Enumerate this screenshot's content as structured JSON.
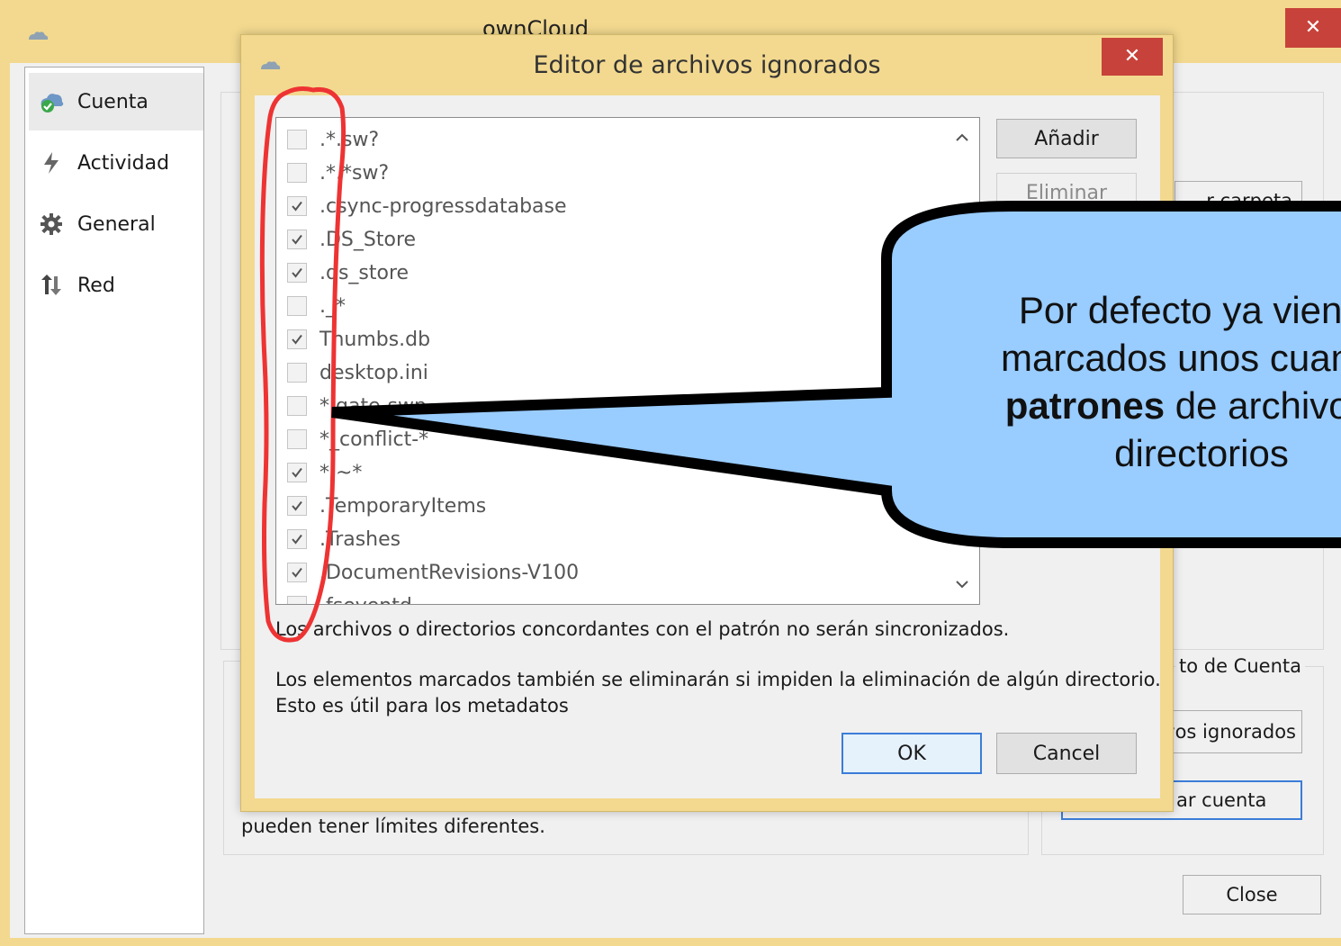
{
  "main_window": {
    "title": "ownCloud",
    "close_glyph": "✕",
    "sidebar": {
      "items": [
        {
          "label": "Cuenta",
          "icon": "account-cloud-check-icon",
          "selected": true
        },
        {
          "label": "Actividad",
          "icon": "activity-bolt-icon",
          "selected": false
        },
        {
          "label": "General",
          "icon": "gear-icon",
          "selected": false
        },
        {
          "label": "Red",
          "icon": "network-arrows-icon",
          "selected": false
        }
      ]
    },
    "background": {
      "folder_button_partial": "r carpeta",
      "account_group_partial": "to de Cuenta",
      "ignored_files_button_partial": "vos ignorados",
      "remove_account_button_partial": "ar cuenta",
      "quota_text_partial": "pueden tener límites diferentes.",
      "close_button": "Close"
    }
  },
  "dialog": {
    "title": "Editor de archivos ignorados",
    "close_glyph": "✕",
    "patterns": [
      {
        "text": ".*.sw?",
        "checked": false
      },
      {
        "text": ".*.*sw?",
        "checked": false
      },
      {
        "text": ".csync-progressdatabase",
        "checked": true
      },
      {
        "text": ".DS_Store",
        "checked": true
      },
      {
        "text": ".ds_store",
        "checked": true
      },
      {
        "text": "._*",
        "checked": false
      },
      {
        "text": "Thumbs.db",
        "checked": true
      },
      {
        "text": "desktop.ini",
        "checked": false
      },
      {
        "text": "*.gate-swp",
        "checked": false
      },
      {
        "text": "*_conflict-*",
        "checked": false
      },
      {
        "text": "*.~*",
        "checked": true
      },
      {
        "text": ".TemporaryItems",
        "checked": true
      },
      {
        "text": ".Trashes",
        "checked": true
      },
      {
        "text": ".DocumentRevisions-V100",
        "checked": true
      },
      {
        "text": ".fseventd",
        "checked": false
      }
    ],
    "add_button": "Añadir",
    "remove_button": "Eliminar",
    "info_line1": "Los archivos o directorios concordantes con el patrón no serán sincronizados.",
    "info_line2": "Los elementos marcados también se eliminarán si impiden la eliminación de algún directorio.",
    "info_line3": "Esto es útil para los metadatos",
    "ok_button": "OK",
    "cancel_button": "Cancel"
  },
  "annotation": {
    "callout_line1": "Por defecto ya vienen",
    "callout_line2": "marcados unos cuantos",
    "callout_bold": "patrones",
    "callout_line3_rest": " de archivos y",
    "callout_line4": "directorios",
    "bubble_fill": "#99ccff",
    "highlight_color": "#ee3333"
  }
}
